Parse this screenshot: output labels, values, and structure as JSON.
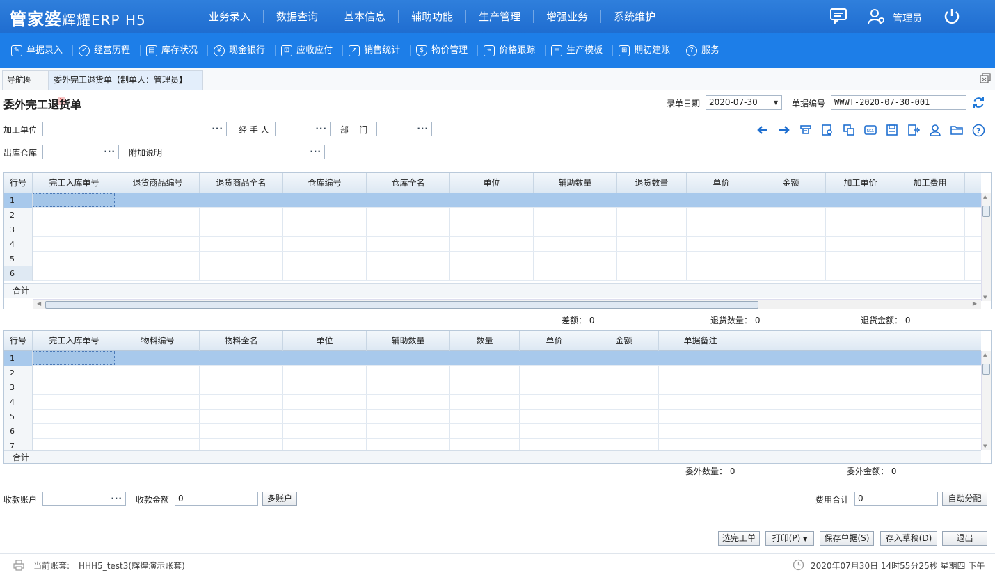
{
  "app": {
    "brand": "管家婆",
    "brand_sub": "辉耀ERP H5",
    "user": "管理员"
  },
  "main_menu": [
    "业务录入",
    "数据查询",
    "基本信息",
    "辅助功能",
    "生产管理",
    "增强业务",
    "系统维护"
  ],
  "toolbar": [
    {
      "label": "单据录入",
      "icon": "edit-icon"
    },
    {
      "label": "经营历程",
      "icon": "history-icon"
    },
    {
      "label": "库存状况",
      "icon": "inventory-icon"
    },
    {
      "label": "现金银行",
      "icon": "yen-icon"
    },
    {
      "label": "应收应付",
      "icon": "ledger-icon"
    },
    {
      "label": "销售统计",
      "icon": "chart-icon"
    },
    {
      "label": "物价管理",
      "icon": "shield-icon"
    },
    {
      "label": "价格跟踪",
      "icon": "tracking-icon"
    },
    {
      "label": "生产模板",
      "icon": "template-icon"
    },
    {
      "label": "期初建账",
      "icon": "book-icon"
    },
    {
      "label": "服务",
      "icon": "help-icon"
    }
  ],
  "tabs": {
    "nav": "导航图",
    "doc": "委外完工退货单【制单人：管理员】"
  },
  "form": {
    "title": "委外完工退货单",
    "date_label": "录单日期",
    "date_value": "2020-07-30",
    "no_label": "单据编号",
    "no_value": "WWWT-2020-07-30-001",
    "unit_label": "加工单位",
    "handler_label": "经 手 人",
    "dept_label": "部    门",
    "warehouse_label": "出库仓库",
    "remark_label": "附加说明",
    "account_label": "收款账户",
    "amount_label": "收款金额",
    "amount_value": "0",
    "multi_account": "多账户",
    "fee_label": "费用合计",
    "fee_value": "0",
    "auto_alloc": "自动分配"
  },
  "grid1": {
    "headers": [
      "行号",
      "完工入库单号",
      "退货商品编号",
      "退货商品全名",
      "仓库编号",
      "仓库全名",
      "单位",
      "辅助数量",
      "退货数量",
      "单价",
      "金额",
      "加工单价",
      "加工费用"
    ],
    "rows": [
      "1",
      "2",
      "3",
      "4",
      "5",
      "6"
    ],
    "sum": "合计",
    "stats": {
      "diff_label": "差额：",
      "diff": "0",
      "qty_label": "退货数量：",
      "qty": "0",
      "amt_label": "退货金额：",
      "amt": "0"
    }
  },
  "grid2": {
    "headers": [
      "行号",
      "完工入库单号",
      "物料编号",
      "物料全名",
      "单位",
      "辅助数量",
      "数量",
      "单价",
      "金额",
      "单据备注"
    ],
    "rows": [
      "1",
      "2",
      "3",
      "4",
      "5",
      "6",
      "7"
    ],
    "sum": "合计",
    "stats": {
      "qty_label": "委外数量：",
      "qty": "0",
      "amt_label": "委外金额：",
      "amt": "0"
    }
  },
  "buttons": {
    "select": "选完工单",
    "print": "打印(P)",
    "save": "保存单据(S)",
    "draft": "存入草稿(D)",
    "exit": "退出"
  },
  "status": {
    "account_label": "当前账套:",
    "account": "HHH5_test3(辉煌演示账套)",
    "datetime": "2020年07月30日 14时55分25秒 星期四 下午"
  }
}
